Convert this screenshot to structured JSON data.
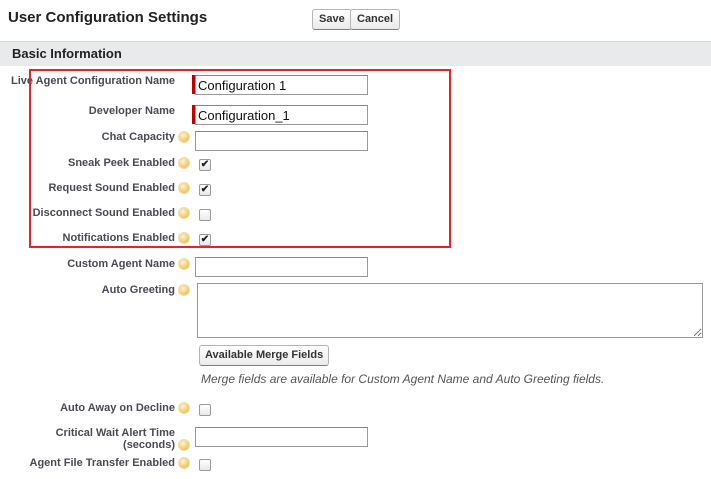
{
  "header": {
    "title": "User Configuration Settings",
    "save_label": "Save",
    "cancel_label": "Cancel"
  },
  "section": {
    "title": "Basic Information"
  },
  "fields": {
    "live_agent_config_name": {
      "label": "Live Agent Configuration Name",
      "value": "Configuration 1",
      "required": true
    },
    "developer_name": {
      "label": "Developer Name",
      "value": "Configuration_1",
      "required": true
    },
    "chat_capacity": {
      "label": "Chat Capacity",
      "value": ""
    },
    "sneak_peek_enabled": {
      "label": "Sneak Peek Enabled",
      "checked": true
    },
    "request_sound_enabled": {
      "label": "Request Sound Enabled",
      "checked": true
    },
    "disconnect_sound_enabled": {
      "label": "Disconnect Sound Enabled",
      "checked": false
    },
    "notifications_enabled": {
      "label": "Notifications Enabled",
      "checked": true
    },
    "custom_agent_name": {
      "label": "Custom Agent Name",
      "value": ""
    },
    "auto_greeting": {
      "label": "Auto Greeting",
      "value": ""
    },
    "auto_away_on_decline": {
      "label": "Auto Away on Decline",
      "checked": false
    },
    "critical_wait_alert_time": {
      "label": "Critical Wait Alert Time (seconds)",
      "value": ""
    },
    "agent_file_transfer_enabled": {
      "label": "Agent File Transfer Enabled",
      "checked": false
    }
  },
  "merge_fields": {
    "button_label": "Available Merge Fields",
    "hint": "Merge fields are available for Custom Agent Name and Auto Greeting fields."
  },
  "icons": {
    "help": "help-icon",
    "check": "checkmark-icon"
  },
  "colors": {
    "required": "#c00000",
    "highlight": "#e0252b",
    "help": "#f0c25a"
  }
}
